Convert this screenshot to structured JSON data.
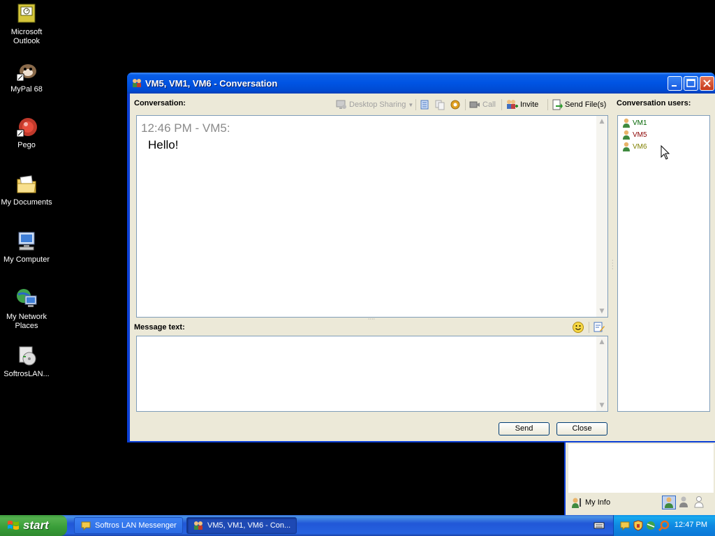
{
  "desktop": {
    "icons": [
      {
        "label": "Microsoft Outlook"
      },
      {
        "label": "MyPal 68"
      },
      {
        "label": "Pego"
      },
      {
        "label": "My Documents"
      },
      {
        "label": "My Computer"
      },
      {
        "label": "My Network Places"
      },
      {
        "label": "SoftrosLAN..."
      }
    ]
  },
  "window": {
    "title": "VM5, VM1, VM6 - Conversation",
    "conversation_label": "Conversation:",
    "toolbar": {
      "desktop_sharing": "Desktop Sharing",
      "call": "Call",
      "invite": "Invite",
      "send_files": "Send File(s)"
    },
    "users_label": "Conversation users:",
    "users": [
      {
        "name": "VM1",
        "color": "#006400"
      },
      {
        "name": "VM5",
        "color": "#8b0000"
      },
      {
        "name": "VM6",
        "color": "#808000"
      }
    ],
    "messages": [
      {
        "time_sender": "12:46 PM - VM5:",
        "text": "Hello!"
      }
    ],
    "message_text_label": "Message text:",
    "message_input_value": "",
    "send_button": "Send",
    "close_button": "Close"
  },
  "messenger": {
    "my_info": "My Info"
  },
  "taskbar": {
    "start": "start",
    "tasks": [
      {
        "label": "Softros LAN Messenger",
        "active": false
      },
      {
        "label": "VM5, VM1, VM6 - Con...",
        "active": true
      }
    ],
    "clock": "12:47 PM"
  },
  "colors": {
    "xp_blue": "#0054e3",
    "window_face": "#ece9d8",
    "start_green": "#389d38"
  }
}
